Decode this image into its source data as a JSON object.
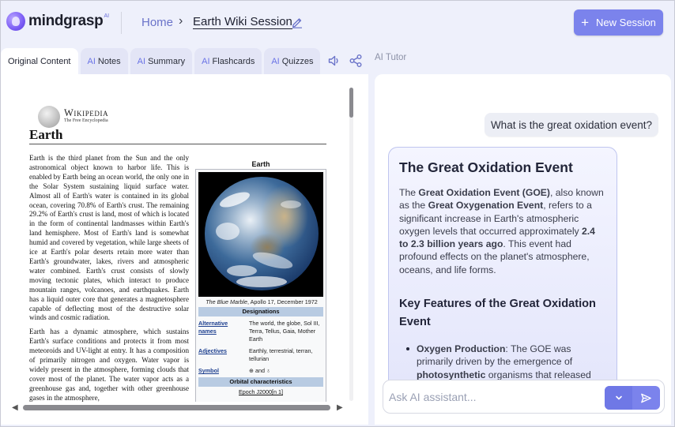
{
  "header": {
    "logo_text": "mindgrasp",
    "logo_sup": "AI",
    "breadcrumb_home": "Home",
    "breadcrumb_sep": "›",
    "breadcrumb_current": "Earth Wiki Session",
    "new_session_label": "New Session",
    "new_session_plus": "+"
  },
  "tabs": [
    {
      "prefix": "",
      "label": "Original Content",
      "active": true
    },
    {
      "prefix": "AI",
      "label": "Notes"
    },
    {
      "prefix": "AI",
      "label": "Summary"
    },
    {
      "prefix": "AI",
      "label": "Flashcards"
    },
    {
      "prefix": "AI",
      "label": "Quizzes"
    }
  ],
  "tab_icons": [
    "speaker-icon",
    "share-icon"
  ],
  "document": {
    "wiki_title": "Wikipedia",
    "wiki_sub": "The Free Encyclopedia",
    "article_title": "Earth",
    "para1": "Earth is the third planet from the Sun and the only astronomical object known to harbor life. This is enabled by Earth being an ocean world, the only one in the Solar System sustaining liquid surface water. Almost all of Earth's water is contained in its global ocean, covering 70.8% of Earth's crust. The remaining 29.2% of Earth's crust is land, most of which is located in the form of continental landmasses within Earth's land hemisphere. Most of Earth's land is somewhat humid and covered by vegetation, while large sheets of ice at Earth's polar deserts retain more water than Earth's groundwater, lakes, rivers and atmospheric water combined. Earth's crust consists of slowly moving tectonic plates, which interact to produce mountain ranges, volcanoes, and earthquakes. Earth has a liquid outer core that generates a magnetosphere capable of deflecting most of the destructive solar winds and cosmic radiation.",
    "para2": "Earth has a dynamic atmosphere, which sustains Earth's surface conditions and protects it from most meteoroids and UV-light at entry. It has a composition of primarily nitrogen and oxygen. Water vapor is widely present in the atmosphere, forming clouds that cover most of the planet. The water vapor acts as a greenhouse gas and, together with other greenhouse gases in the atmosphere,",
    "infobox": {
      "title": "Earth",
      "caption_italic": "The Blue Marble",
      "caption_rest": ", Apollo 17, December 1972",
      "section_designations": "Designations",
      "rows": [
        {
          "key": "Alternative names",
          "value": "The world, the globe, Sol III, Terra, Tellus, Gaia, Mother Earth"
        },
        {
          "key": "Adjectives",
          "value": "Earthly, terrestrial, terran, tellurian"
        },
        {
          "key": "Symbol",
          "value": "⊕ and ♁"
        }
      ],
      "section_orbital": "Orbital characteristics",
      "epoch": "Epoch J2000[n 1]"
    }
  },
  "tutor": {
    "label": "AI Tutor",
    "user_question": "What is the great oxidation event?",
    "answer_title": "The Great Oxidation Event",
    "answer_intro_1": "The ",
    "answer_intro_b1": "Great Oxidation Event (GOE)",
    "answer_intro_2": ", also known as the ",
    "answer_intro_b2": "Great Oxygenation Event",
    "answer_intro_3": ", refers to a significant increase in Earth's atmospheric oxygen levels that occurred approximately ",
    "answer_intro_b3": "2.4 to 2.3 billion years ago",
    "answer_intro_4": ". This event had profound effects on the planet's atmosphere, oceans, and life forms.",
    "features_heading": "Key Features of the Great Oxidation Event",
    "bullet1_bold": "Oxygen Production",
    "bullet1_text": ": The GOE was primarily driven by the emergence of ",
    "bullet1_bold2": "photosynthetic",
    "bullet1_tail": " organisms that released oxygen",
    "input_placeholder": "Ask AI assistant..."
  },
  "colors": {
    "accent": "#7b83ec",
    "ai_label": "#6a73e6",
    "background": "#eef0fb"
  }
}
